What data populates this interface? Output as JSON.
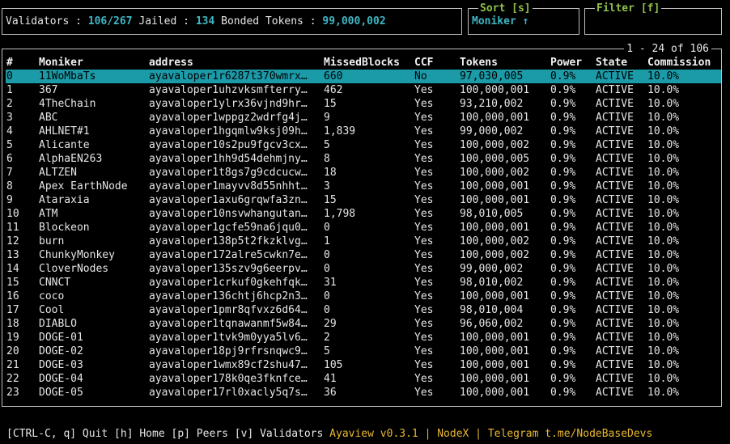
{
  "summary": {
    "validators_label": "Validators : ",
    "validators_value": "106/267",
    "jailed_label": " Jailed : ",
    "jailed_value": "134",
    "bonded_label": " Bonded Tokens : ",
    "bonded_value": "99,000,002"
  },
  "sort": {
    "title": "Sort [s]",
    "value": "Moniker ↑"
  },
  "filter": {
    "title": "Filter [f]",
    "value": ""
  },
  "table": {
    "pagination": "1 - 24 of 106",
    "headers": [
      "#",
      "Moniker",
      "address",
      "MissedBlocks",
      "CCF",
      "Tokens",
      "Power",
      "State",
      "Commission"
    ],
    "rows": [
      [
        "0",
        "11WoMbaTs",
        "ayavaloper1r6287t370wmrx…",
        "660",
        "No",
        "97,030,005",
        "0.9%",
        "ACTIVE",
        "10.0%"
      ],
      [
        "1",
        "367",
        "ayavaloper1uhzvksmfterry…",
        "462",
        "Yes",
        "100,000,001",
        "0.9%",
        "ACTIVE",
        "10.0%"
      ],
      [
        "2",
        "4TheChain",
        "ayavaloper1ylrx36vjnd9hr…",
        "15",
        "Yes",
        "93,210,002",
        "0.9%",
        "ACTIVE",
        "10.0%"
      ],
      [
        "3",
        "ABC",
        "ayavaloper1wppgz2wdrfg4j…",
        "9",
        "Yes",
        "100,000,001",
        "0.9%",
        "ACTIVE",
        "10.0%"
      ],
      [
        "4",
        "AHLNET#1",
        "ayavaloper1hgqmlw9ksj09h…",
        "1,839",
        "Yes",
        "99,000,002",
        "0.9%",
        "ACTIVE",
        "10.0%"
      ],
      [
        "5",
        "Alicante",
        "ayavaloper10s2pu9fgcv3cx…",
        "5",
        "Yes",
        "100,000,002",
        "0.9%",
        "ACTIVE",
        "10.0%"
      ],
      [
        "6",
        "AlphaEN263",
        "ayavaloper1hh9d54dehmjny…",
        "8",
        "Yes",
        "100,000,005",
        "0.9%",
        "ACTIVE",
        "10.0%"
      ],
      [
        "7",
        "ALTZEN",
        "ayavaloper1t8gs7g9cdcucw…",
        "18",
        "Yes",
        "100,000,002",
        "0.9%",
        "ACTIVE",
        "10.0%"
      ],
      [
        "8",
        "Apex EarthNode",
        "ayavaloper1mayvv8d55nhht…",
        "3",
        "Yes",
        "100,000,001",
        "0.9%",
        "ACTIVE",
        "10.0%"
      ],
      [
        "9",
        "Ataraxia",
        "ayavaloper1axu6grqwfa3zn…",
        "15",
        "Yes",
        "100,000,001",
        "0.9%",
        "ACTIVE",
        "10.0%"
      ],
      [
        "10",
        "ATM",
        "ayavaloper10nsvwhangutan…",
        "1,798",
        "Yes",
        "98,010,005",
        "0.9%",
        "ACTIVE",
        "10.0%"
      ],
      [
        "11",
        "Blockeon",
        "ayavaloper1gcfe59na6jqu0…",
        "0",
        "Yes",
        "100,000,001",
        "0.9%",
        "ACTIVE",
        "10.0%"
      ],
      [
        "12",
        "burn",
        "ayavaloper138p5t2fkzklvg…",
        "1",
        "Yes",
        "100,000,002",
        "0.9%",
        "ACTIVE",
        "10.0%"
      ],
      [
        "13",
        "ChunkyMonkey",
        "ayavaloper172alre5cwkn7e…",
        "0",
        "Yes",
        "100,000,002",
        "0.9%",
        "ACTIVE",
        "10.0%"
      ],
      [
        "14",
        "CloverNodes",
        "ayavaloper135szv9g6eerpv…",
        "0",
        "Yes",
        "99,000,002",
        "0.9%",
        "ACTIVE",
        "10.0%"
      ],
      [
        "15",
        "CNNCT",
        "ayavaloper1crkuf0gkehfqk…",
        "31",
        "Yes",
        "98,010,002",
        "0.9%",
        "ACTIVE",
        "10.0%"
      ],
      [
        "16",
        "coco",
        "ayavaloper136chtj6hcp2n3…",
        "0",
        "Yes",
        "100,000,001",
        "0.9%",
        "ACTIVE",
        "10.0%"
      ],
      [
        "17",
        "Cool",
        "ayavaloper1pmr8qfvxz6d64…",
        "0",
        "Yes",
        "98,010,004",
        "0.9%",
        "ACTIVE",
        "10.0%"
      ],
      [
        "18",
        "DIABLO",
        "ayavaloper1tqnawanmf5w84…",
        "29",
        "Yes",
        "96,060,002",
        "0.9%",
        "ACTIVE",
        "10.0%"
      ],
      [
        "19",
        "DOGE-01",
        "ayavaloper1tvk9m0yya5lv6…",
        "2",
        "Yes",
        "100,000,001",
        "0.9%",
        "ACTIVE",
        "10.0%"
      ],
      [
        "20",
        "DOGE-02",
        "ayavaloper18pj9rfrsnqwc9…",
        "5",
        "Yes",
        "100,000,001",
        "0.9%",
        "ACTIVE",
        "10.0%"
      ],
      [
        "21",
        "DOGE-03",
        "ayavaloper1wmx89cf2shu47…",
        "105",
        "Yes",
        "100,000,001",
        "0.9%",
        "ACTIVE",
        "10.0%"
      ],
      [
        "22",
        "DOGE-04",
        "ayavaloper178k0qe3fknfce…",
        "41",
        "Yes",
        "100,000,001",
        "0.9%",
        "ACTIVE",
        "10.0%"
      ],
      [
        "23",
        "DOGE-05",
        "ayavaloper17rl0xacly5q7s…",
        "36",
        "Yes",
        "100,000,001",
        "0.9%",
        "ACTIVE",
        "10.0%"
      ]
    ]
  },
  "footer": {
    "keys": "[CTRL-C, q] Quit [h] Home [p] Peers [v] Validators ",
    "info": "Ayaview v0.3.1 | NodeX | Telegram t.me/NodeBaseDevs"
  }
}
